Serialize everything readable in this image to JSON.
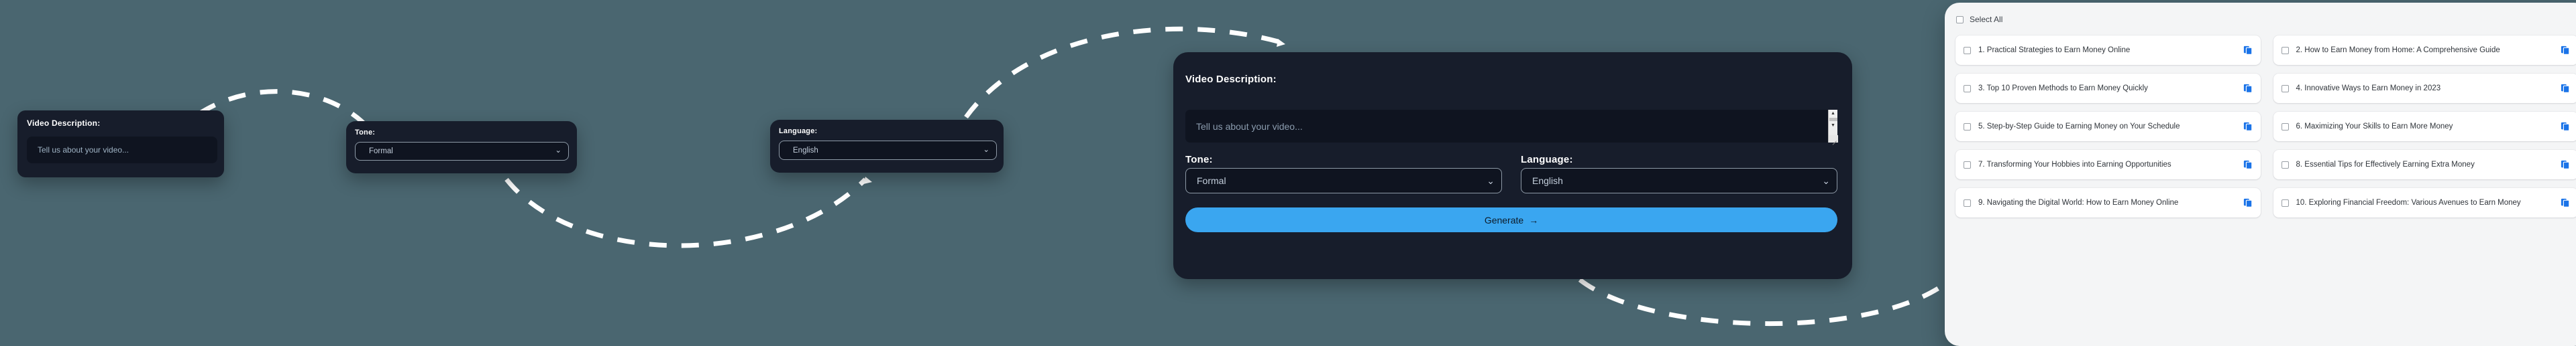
{
  "theme": {
    "background": "#4a6670",
    "card_bg": "#171d2b",
    "field_bg": "#0f1420",
    "accent_blue": "#3aa6f0",
    "copy_icon_blue": "#1a73e8",
    "panel_bg": "#f4f5f6",
    "item_bg": "#ffffff"
  },
  "step1": {
    "description_label": "Video Description:",
    "description_placeholder": "Tell us about your video..."
  },
  "step2": {
    "tone_label": "Tone:",
    "tone_value": "Formal",
    "chevron": "⌄"
  },
  "step3": {
    "language_label": "Language:",
    "language_value": "English",
    "chevron": "⌄"
  },
  "main_form": {
    "description_label": "Video Description:",
    "description_placeholder": "Tell us about your video...",
    "tone_label": "Tone:",
    "tone_value": "Formal",
    "language_label": "Language:",
    "language_value": "English",
    "generate_label": "Generate",
    "generate_arrow": "→",
    "chevron": "⌄",
    "scroll_up": "▲",
    "scroll_down": "▼"
  },
  "results": {
    "select_all_label": "Select All",
    "items": [
      {
        "text": "1. Practical Strategies to Earn Money Online"
      },
      {
        "text": "2. How to Earn Money from Home: A Comprehensive Guide"
      },
      {
        "text": "3. Top 10 Proven Methods to Earn Money Quickly"
      },
      {
        "text": "4. Innovative Ways to Earn Money in 2023"
      },
      {
        "text": "5. Step-by-Step Guide to Earning Money on Your Schedule"
      },
      {
        "text": "6. Maximizing Your Skills to Earn More Money"
      },
      {
        "text": "7. Transforming Your Hobbies into Earning Opportunities"
      },
      {
        "text": "8. Essential Tips for Effectively Earning Extra Money"
      },
      {
        "text": "9. Navigating the Digital World: How to Earn Money Online"
      },
      {
        "text": "10. Exploring Financial Freedom: Various Avenues to Earn Money"
      }
    ]
  }
}
